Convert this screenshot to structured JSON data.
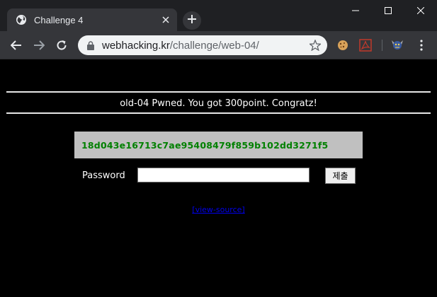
{
  "browser": {
    "tab_title": "Challenge 4",
    "url_host": "webhacking.kr",
    "url_path": "/challenge/web-04/",
    "accent": "#35363a"
  },
  "page": {
    "pwned_message": "old-04 Pwned. You got 300point. Congratz!",
    "hash": "18d043e16713c7ae95408479f859b102dd3271f5",
    "password_label": "Password",
    "password_value": "",
    "submit_label": "제출",
    "view_source_label": "[view-source]",
    "colors": {
      "background": "#000000",
      "hash_text": "#008000",
      "hash_box": "#c0c0c0",
      "link": "#0000ee"
    }
  },
  "icons": [
    "globe-icon",
    "close-icon",
    "plus-icon",
    "minimize-icon",
    "maximize-icon",
    "window-close-icon",
    "back-arrow-icon",
    "forward-arrow-icon",
    "reload-icon",
    "lock-icon",
    "star-icon",
    "cookie-extension-icon",
    "pdf-extension-icon",
    "avatar-extension-icon",
    "menu-kebab-icon"
  ]
}
